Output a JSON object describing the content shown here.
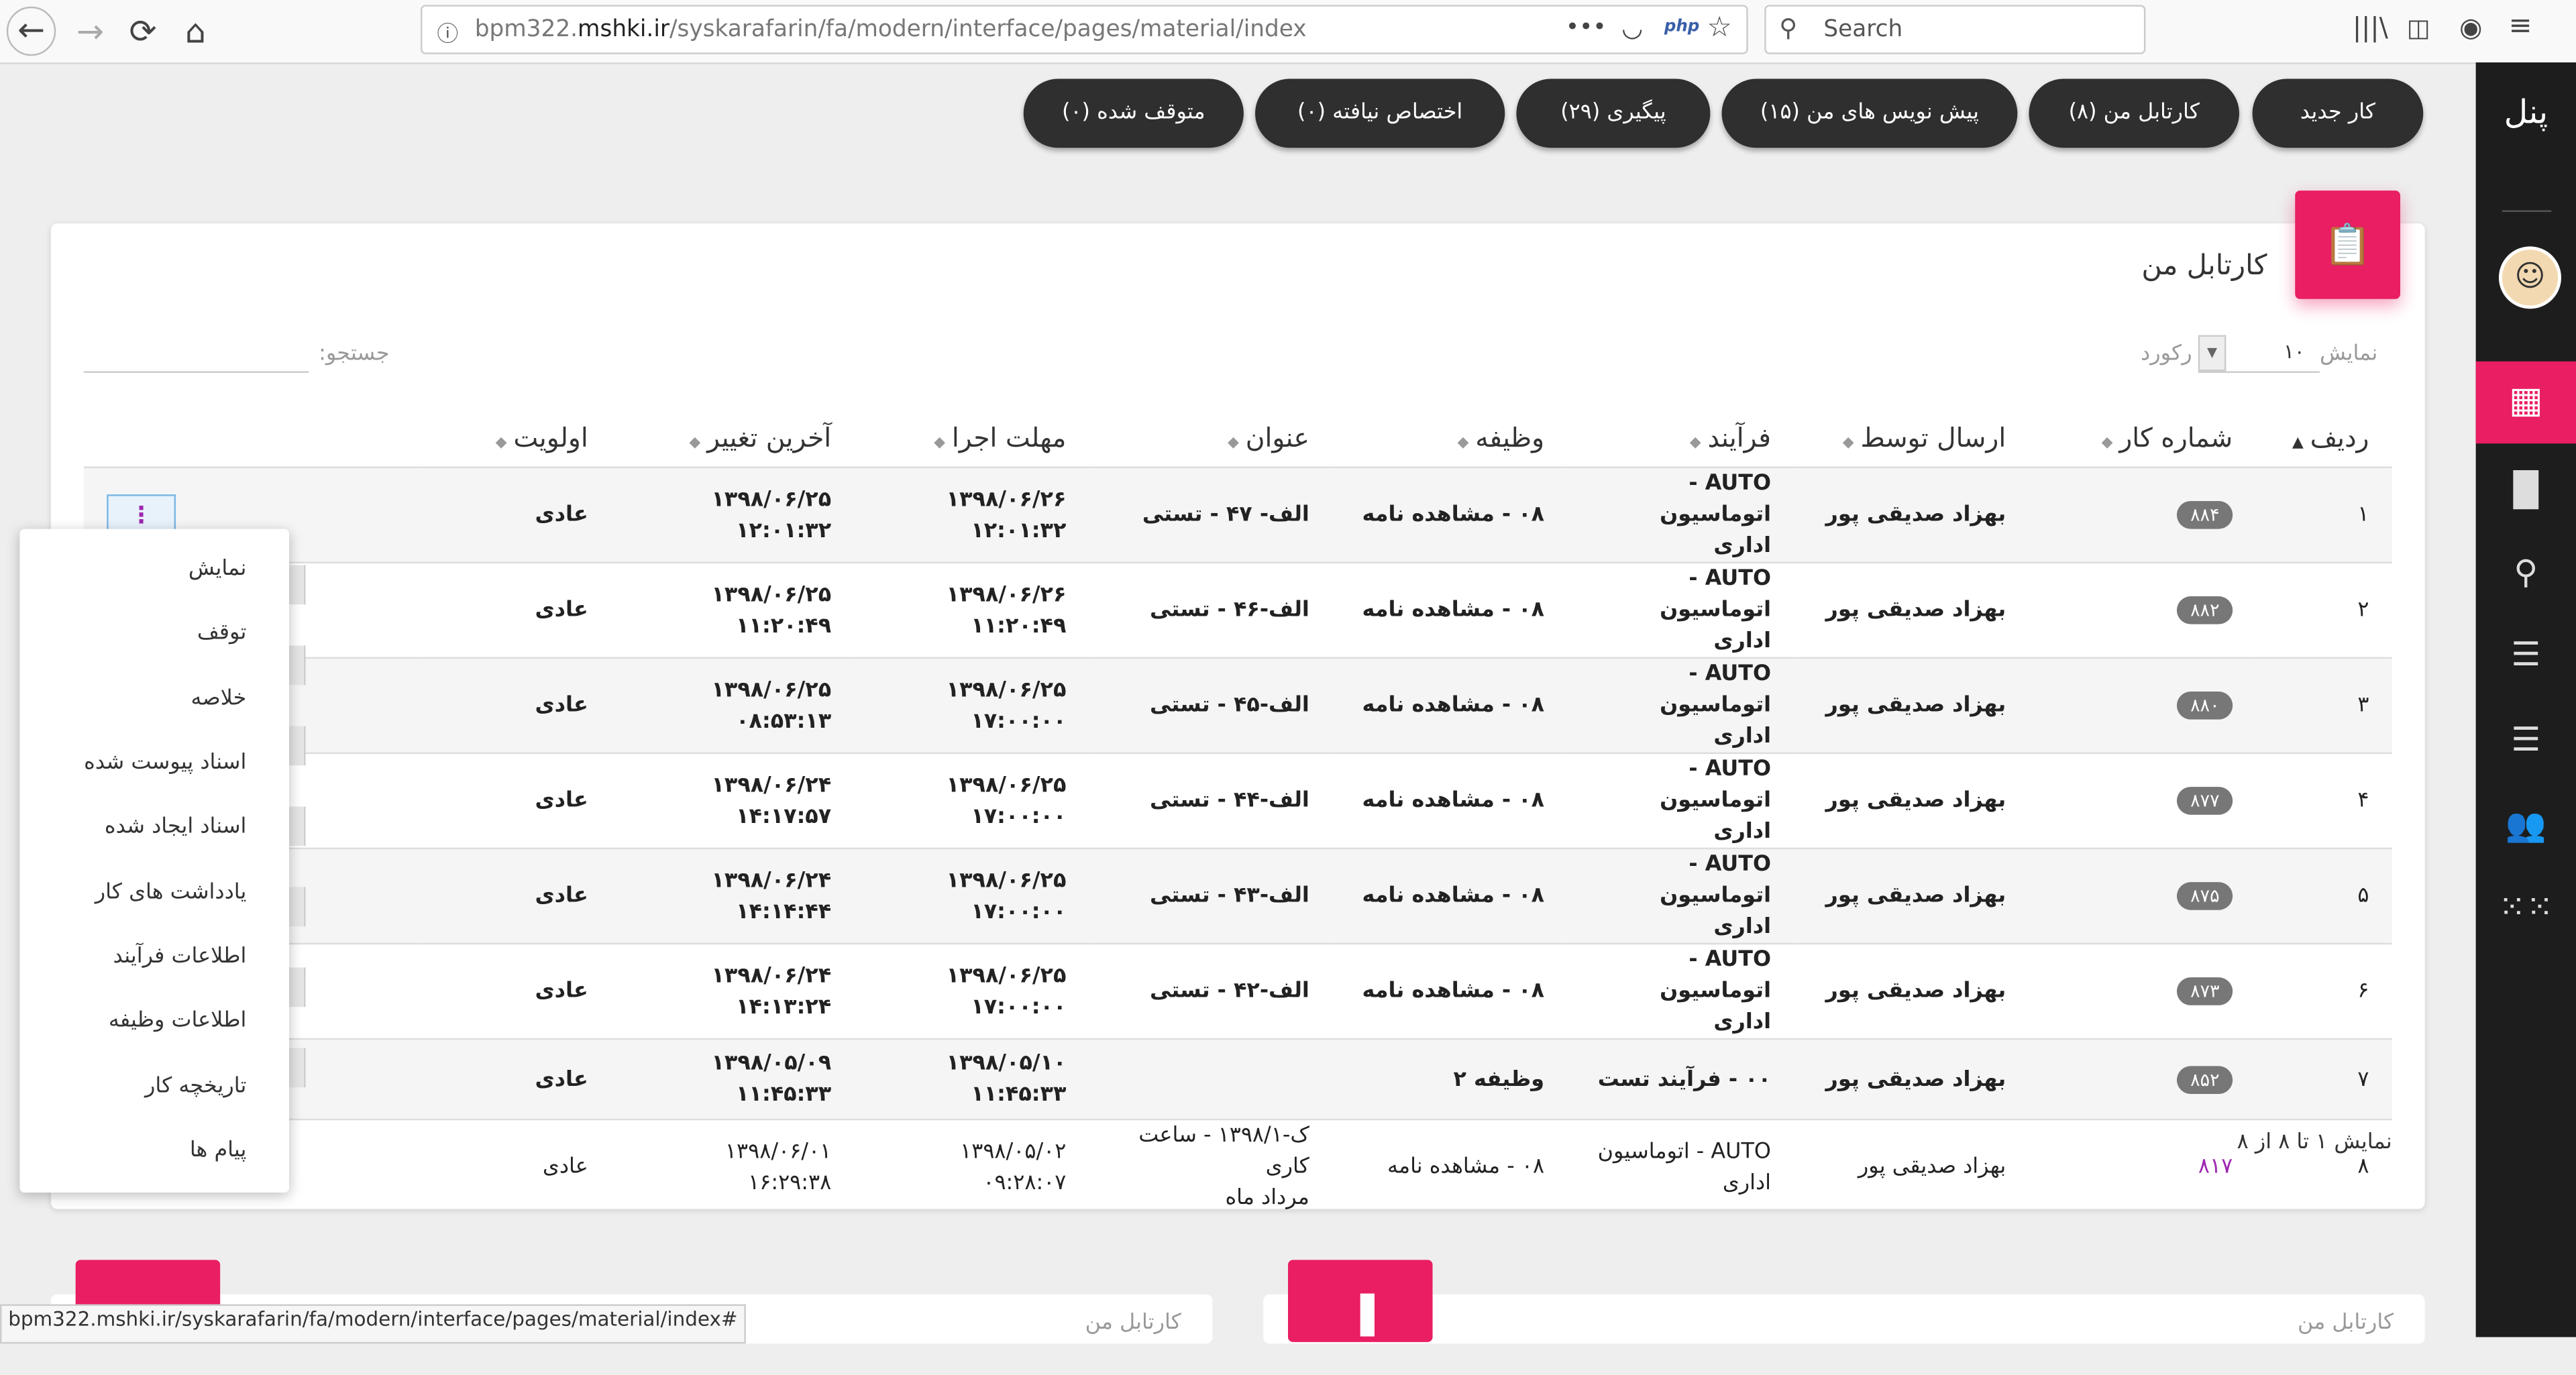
{
  "browser": {
    "url_prefix": "bpm322.",
    "url_domain": "mshki.ir",
    "url_path": "/syskarafarin/fa/modern/interface/pages/material/index",
    "php_badge": "php",
    "search_placeholder": "Search"
  },
  "top_buttons": [
    {
      "label": "کار جدید"
    },
    {
      "label": "کارتابل من (۸)"
    },
    {
      "label": "پیش نویس های من (۱۵)"
    },
    {
      "label": "پیگیری (۲۹)"
    },
    {
      "label": "اختصاص نیافته (۰)"
    },
    {
      "label": "متوقف شده (۰)"
    }
  ],
  "sidebar": {
    "title": "پنل"
  },
  "card": {
    "title": "کارتابل من",
    "show_label": "نمایش",
    "page_size": "۱۰",
    "records_label": "رکورد",
    "search_label": "جستجو:",
    "footer": "نمایش ۱ تا ۸ از ۸"
  },
  "table": {
    "headers": [
      "ردیف",
      "شماره کار",
      "ارسال توسط",
      "فرآیند",
      "وظیفه",
      "عنوان",
      "مهلت اجرا",
      "آخرین تغییر",
      "اولویت"
    ],
    "rows": [
      {
        "row": "۱",
        "id": "۸۸۴",
        "sender": "بهزاد صدیقی پور",
        "process_1": "AUTO - اتوماسیون",
        "process_2": "اداری",
        "task": "۰۸ - مشاهده نامه",
        "subject_1": "الف- ۴۷ - تستی",
        "subject_2": "",
        "due_1": "۱۳۹۸/۰۶/۲۶",
        "due_2": "۱۲:۰۱:۳۲",
        "changed_1": "۱۳۹۸/۰۶/۲۵",
        "changed_2": "۱۲:۰۱:۳۲",
        "priority": "عادی"
      },
      {
        "row": "۲",
        "id": "۸۸۲",
        "sender": "بهزاد صدیقی پور",
        "process_1": "AUTO - اتوماسیون",
        "process_2": "اداری",
        "task": "۰۸ - مشاهده نامه",
        "subject_1": "الف-۴۶ - تستی",
        "subject_2": "",
        "due_1": "۱۳۹۸/۰۶/۲۶",
        "due_2": "۱۱:۲۰:۴۹",
        "changed_1": "۱۳۹۸/۰۶/۲۵",
        "changed_2": "۱۱:۲۰:۴۹",
        "priority": "عادی"
      },
      {
        "row": "۳",
        "id": "۸۸۰",
        "sender": "بهزاد صدیقی پور",
        "process_1": "AUTO - اتوماسیون",
        "process_2": "اداری",
        "task": "۰۸ - مشاهده نامه",
        "subject_1": "الف-۴۵ - تستی",
        "subject_2": "",
        "due_1": "۱۳۹۸/۰۶/۲۵",
        "due_2": "۱۷:۰۰:۰۰",
        "changed_1": "۱۳۹۸/۰۶/۲۵",
        "changed_2": "۰۸:۵۳:۱۳",
        "priority": "عادی"
      },
      {
        "row": "۴",
        "id": "۸۷۷",
        "sender": "بهزاد صدیقی پور",
        "process_1": "AUTO - اتوماسیون",
        "process_2": "اداری",
        "task": "۰۸ - مشاهده نامه",
        "subject_1": "الف-۴۴ - تستی",
        "subject_2": "",
        "due_1": "۱۳۹۸/۰۶/۲۵",
        "due_2": "۱۷:۰۰:۰۰",
        "changed_1": "۱۳۹۸/۰۶/۲۴",
        "changed_2": "۱۴:۱۷:۵۷",
        "priority": "عادی"
      },
      {
        "row": "۵",
        "id": "۸۷۵",
        "sender": "بهزاد صدیقی پور",
        "process_1": "AUTO - اتوماسیون",
        "process_2": "اداری",
        "task": "۰۸ - مشاهده نامه",
        "subject_1": "الف-۴۳ - تستی",
        "subject_2": "",
        "due_1": "۱۳۹۸/۰۶/۲۵",
        "due_2": "۱۷:۰۰:۰۰",
        "changed_1": "۱۳۹۸/۰۶/۲۴",
        "changed_2": "۱۴:۱۴:۴۴",
        "priority": "عادی"
      },
      {
        "row": "۶",
        "id": "۸۷۳",
        "sender": "بهزاد صدیقی پور",
        "process_1": "AUTO - اتوماسیون",
        "process_2": "اداری",
        "task": "۰۸ - مشاهده نامه",
        "subject_1": "الف-۴۲ - تستی",
        "subject_2": "",
        "due_1": "۱۳۹۸/۰۶/۲۵",
        "due_2": "۱۷:۰۰:۰۰",
        "changed_1": "۱۳۹۸/۰۶/۲۴",
        "changed_2": "۱۴:۱۳:۲۴",
        "priority": "عادی"
      },
      {
        "row": "۷",
        "id": "۸۵۲",
        "sender": "بهزاد صدیقی پور",
        "process_1": "۰۰ - فرآیند تست",
        "process_2": "",
        "task": "وظیفه ۲",
        "subject_1": "",
        "subject_2": "",
        "due_1": "۱۳۹۸/۰۵/۱۰",
        "due_2": "۱۱:۴۵:۳۳",
        "changed_1": "۱۳۹۸/۰۵/۰۹",
        "changed_2": "۱۱:۴۵:۳۳",
        "priority": "عادی"
      },
      {
        "row": "۸",
        "id": "۸۱۷",
        "sender": "بهزاد صدیقی پور",
        "process_1": "AUTO - اتوماسیون",
        "process_2": "اداری",
        "task": "۰۸ - مشاهده نامه",
        "subject_1": "ک-۱۳۹۸/۱ - ساعت کاری",
        "subject_2": "مرداد ماه",
        "due_1": "۱۳۹۸/۰۵/۰۲",
        "due_2": "۰۹:۲۸:۰۷",
        "changed_1": "۱۳۹۸/۰۶/۰۱",
        "changed_2": "۱۶:۲۹:۳۸",
        "priority": "عادی"
      }
    ]
  },
  "context_menu": [
    "نمایش",
    "توقف",
    "خلاصه",
    "اسناد پیوست شده",
    "اسناد ایجاد شده",
    "یادداشت های کار",
    "اطلاعات فرآیند",
    "اطلاعات وظیفه",
    "تاریخچه کار",
    "پیام ها"
  ],
  "bottom": {
    "left_card_title": "کارتابل من",
    "right_card_title": "کارتابل من"
  },
  "status_bar": {
    "url": "bpm322.mshki.ir/syskarafarin/fa/modern/interface/pages/material/index#"
  },
  "colors": {
    "accent": "#e91e63",
    "dark_button": "#2f2f2f",
    "due_red": "#e00000",
    "sidebar": "#1d1d1d"
  }
}
